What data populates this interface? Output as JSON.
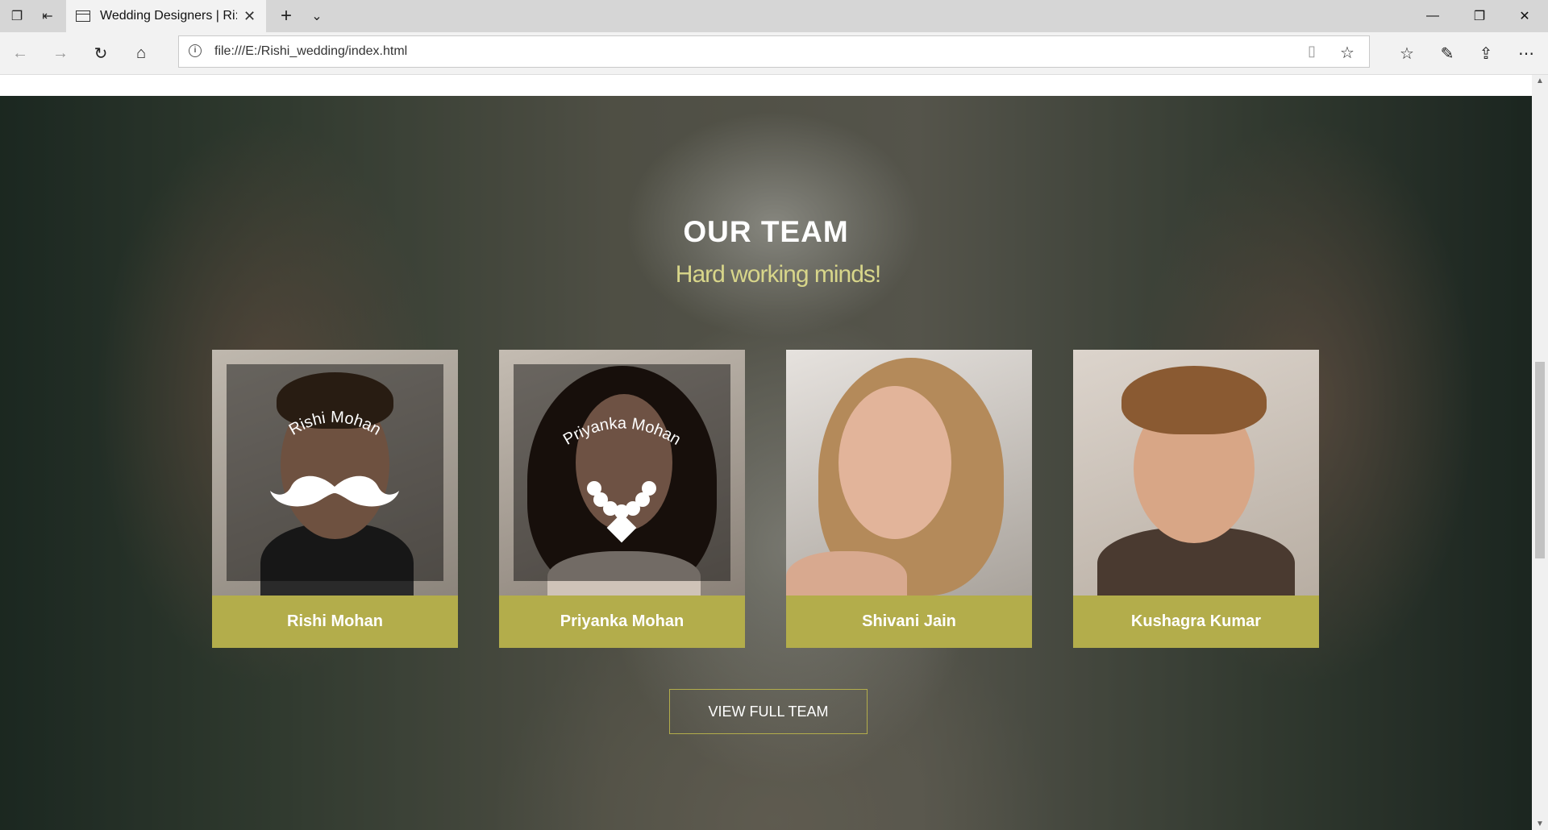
{
  "browser": {
    "tab_title": "Wedding Designers | Ri:",
    "address": "file:///E:/Rishi_wedding/index.html"
  },
  "section": {
    "title": "OUR TEAM",
    "subtitle": "Hard working minds!"
  },
  "team": [
    {
      "name": "Rishi Mohan",
      "overlay_text": "Rishi Mohan",
      "overlay_icon": "mustache-icon"
    },
    {
      "name": "Priyanka Mohan",
      "overlay_text": "Priyanka Mohan",
      "overlay_icon": "necklace-icon"
    },
    {
      "name": "Shivani Jain"
    },
    {
      "name": "Kushagra Kumar"
    }
  ],
  "view_button": "VIEW FULL TEAM",
  "colors": {
    "accent": "#b3ad4b",
    "subtitle": "#d8d68a"
  }
}
